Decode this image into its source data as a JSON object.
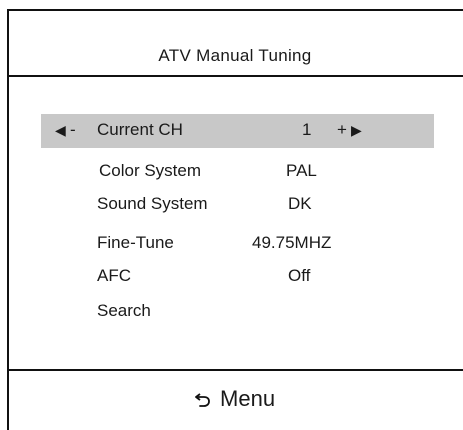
{
  "title": "ATV  Manual Tuning",
  "rows": [
    {
      "label": "Current CH",
      "value": "1",
      "minus": "-",
      "plus": "+"
    },
    {
      "label": "Color System",
      "value": "PAL"
    },
    {
      "label": "Sound System",
      "value": "DK"
    },
    {
      "label": "Fine-Tune",
      "value": "49.75MHZ"
    },
    {
      "label": "AFC",
      "value": "Off"
    },
    {
      "label": "Search"
    }
  ],
  "footer": {
    "menu_label": "Menu",
    "menu_icon": "return-arrow-icon"
  },
  "colors": {
    "selected_bg": "#c8c8c8",
    "border": "#111111"
  }
}
